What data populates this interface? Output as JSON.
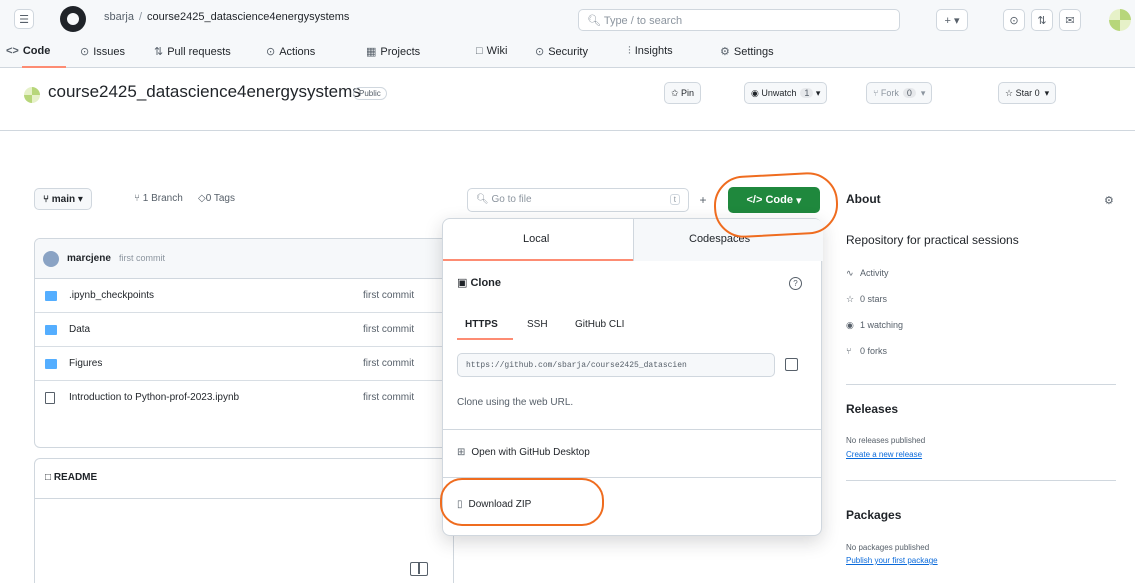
{
  "header": {
    "owner": "sbarja",
    "separator": "/",
    "repo": "course2425_datascience4energysystems",
    "search_placeholder": "Type / to search",
    "new_label": "+ ▾"
  },
  "tabs": [
    {
      "label": "Code",
      "icon": "<>"
    },
    {
      "label": "Issues",
      "icon": "⊙"
    },
    {
      "label": "Pull requests",
      "icon": "⇅"
    },
    {
      "label": "Actions",
      "icon": "⊙"
    },
    {
      "label": "Projects",
      "icon": "▦"
    },
    {
      "label": "Wiki",
      "icon": "□"
    },
    {
      "label": "Security",
      "icon": "⊙"
    },
    {
      "label": "Insights",
      "icon": "⫶"
    },
    {
      "label": "Settings",
      "icon": "⚙"
    }
  ],
  "repo_header": {
    "name": "course2425_datascience4energysystems",
    "visibility": "Public",
    "pin_label": "Pin",
    "unwatch_label": "Unwatch",
    "unwatch_count": "1",
    "fork_label": "Fork",
    "fork_count": "0",
    "star_label": "Star",
    "star_count": "0"
  },
  "toolbar": {
    "branch": "main",
    "branch_count": "1 Branch",
    "tag_count": "0 Tags",
    "goto_placeholder": "Go to file",
    "goto_kbd": "t",
    "plus": "+",
    "code_label": "Code"
  },
  "commit": {
    "user": "marcjene",
    "message": "first commit"
  },
  "files": [
    {
      "name": ".ipynb_checkpoints",
      "commit": "first commit",
      "type": "folder"
    },
    {
      "name": "Data",
      "commit": "first commit",
      "type": "folder"
    },
    {
      "name": "Figures",
      "commit": "first commit",
      "type": "folder"
    },
    {
      "name": "Introduction to Python-prof-2023.ipynb",
      "commit": "first commit",
      "type": "file"
    }
  ],
  "readme": {
    "title": "README"
  },
  "dropdown": {
    "tab_local": "Local",
    "tab_codespaces": "Codespaces",
    "clone_label": "Clone",
    "protocols": [
      "HTTPS",
      "SSH",
      "GitHub CLI"
    ],
    "url": "https://github.com/sbarja/course2425_datascien",
    "hint": "Clone using the web URL.",
    "open_desktop": "Open with GitHub Desktop",
    "download_zip": "Download ZIP"
  },
  "about": {
    "title": "About",
    "description": "Repository for practical sessions",
    "activity": "Activity",
    "stars": "0 stars",
    "watching": "1 watching",
    "forks": "0 forks",
    "releases_title": "Releases",
    "releases_note": "No releases published",
    "releases_link": "Create a new release",
    "packages_title": "Packages",
    "packages_note": "No packages published",
    "packages_link": "Publish your first package"
  },
  "colors": {
    "code_button": "#1f883d",
    "annotation": "#ef6c1f",
    "active_tab": "#fd8c73",
    "link": "#0969da"
  }
}
